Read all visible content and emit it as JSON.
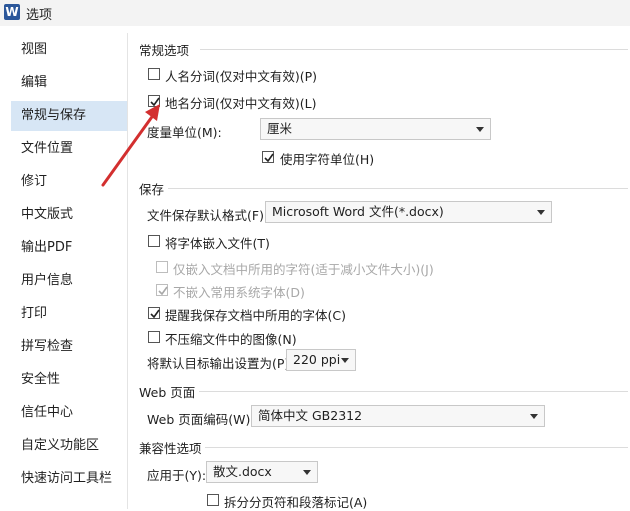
{
  "window": {
    "title": "选项",
    "app_icon": "W"
  },
  "sidebar": {
    "items": [
      {
        "label": "视图"
      },
      {
        "label": "编辑"
      },
      {
        "label": "常规与保存"
      },
      {
        "label": "文件位置"
      },
      {
        "label": "修订"
      },
      {
        "label": "中文版式"
      },
      {
        "label": "输出PDF"
      },
      {
        "label": "用户信息"
      },
      {
        "label": "打印"
      },
      {
        "label": "拼写检查"
      },
      {
        "label": "安全性"
      },
      {
        "label": "信任中心"
      },
      {
        "label": "自定义功能区"
      },
      {
        "label": "快速访问工具栏"
      }
    ],
    "active": "常规与保存"
  },
  "general": {
    "title": "常规选项",
    "person_split": {
      "label": "人名分词(仅对中文有效)(P)",
      "checked": false
    },
    "place_split": {
      "label": "地名分词(仅对中文有效)(L)",
      "checked": true
    },
    "measure_label": "度量单位(M):",
    "measure_value": "厘米",
    "char_unit": {
      "label": "使用字符单位(H)",
      "checked": true
    }
  },
  "save": {
    "title": "保存",
    "format_label": "文件保存默认格式(F):",
    "format_value": "Microsoft Word 文件(*.docx)",
    "embed_fonts": {
      "label": "将字体嵌入文件(T)",
      "checked": false
    },
    "embed_used_only": {
      "label": "仅嵌入文档中所用的字符(适于减小文件大小)(J)",
      "checked": false,
      "disabled": true
    },
    "no_system_fonts": {
      "label": "不嵌入常用系统字体(D)",
      "checked": true,
      "disabled": true
    },
    "remind_fonts": {
      "label": "提醒我保存文档中所用的字体(C)",
      "checked": true
    },
    "no_compress": {
      "label": "不压缩文件中的图像(N)",
      "checked": false
    },
    "output_label": "将默认目标输出设置为(P):",
    "output_value": "220 ppi"
  },
  "web": {
    "title": "Web 页面",
    "encoding_label": "Web 页面编码(W):",
    "encoding_value": "简体中文 GB2312"
  },
  "compat": {
    "title": "兼容性选项",
    "apply_label": "应用于(Y):",
    "apply_value": "散文.docx",
    "split_marks": {
      "label": "拆分分页符和段落标记(A)",
      "checked": false
    }
  },
  "colors": {
    "accent": "#2b579a",
    "active_bg": "#d7e6f5",
    "annotation_arrow": "#d32f2f"
  }
}
